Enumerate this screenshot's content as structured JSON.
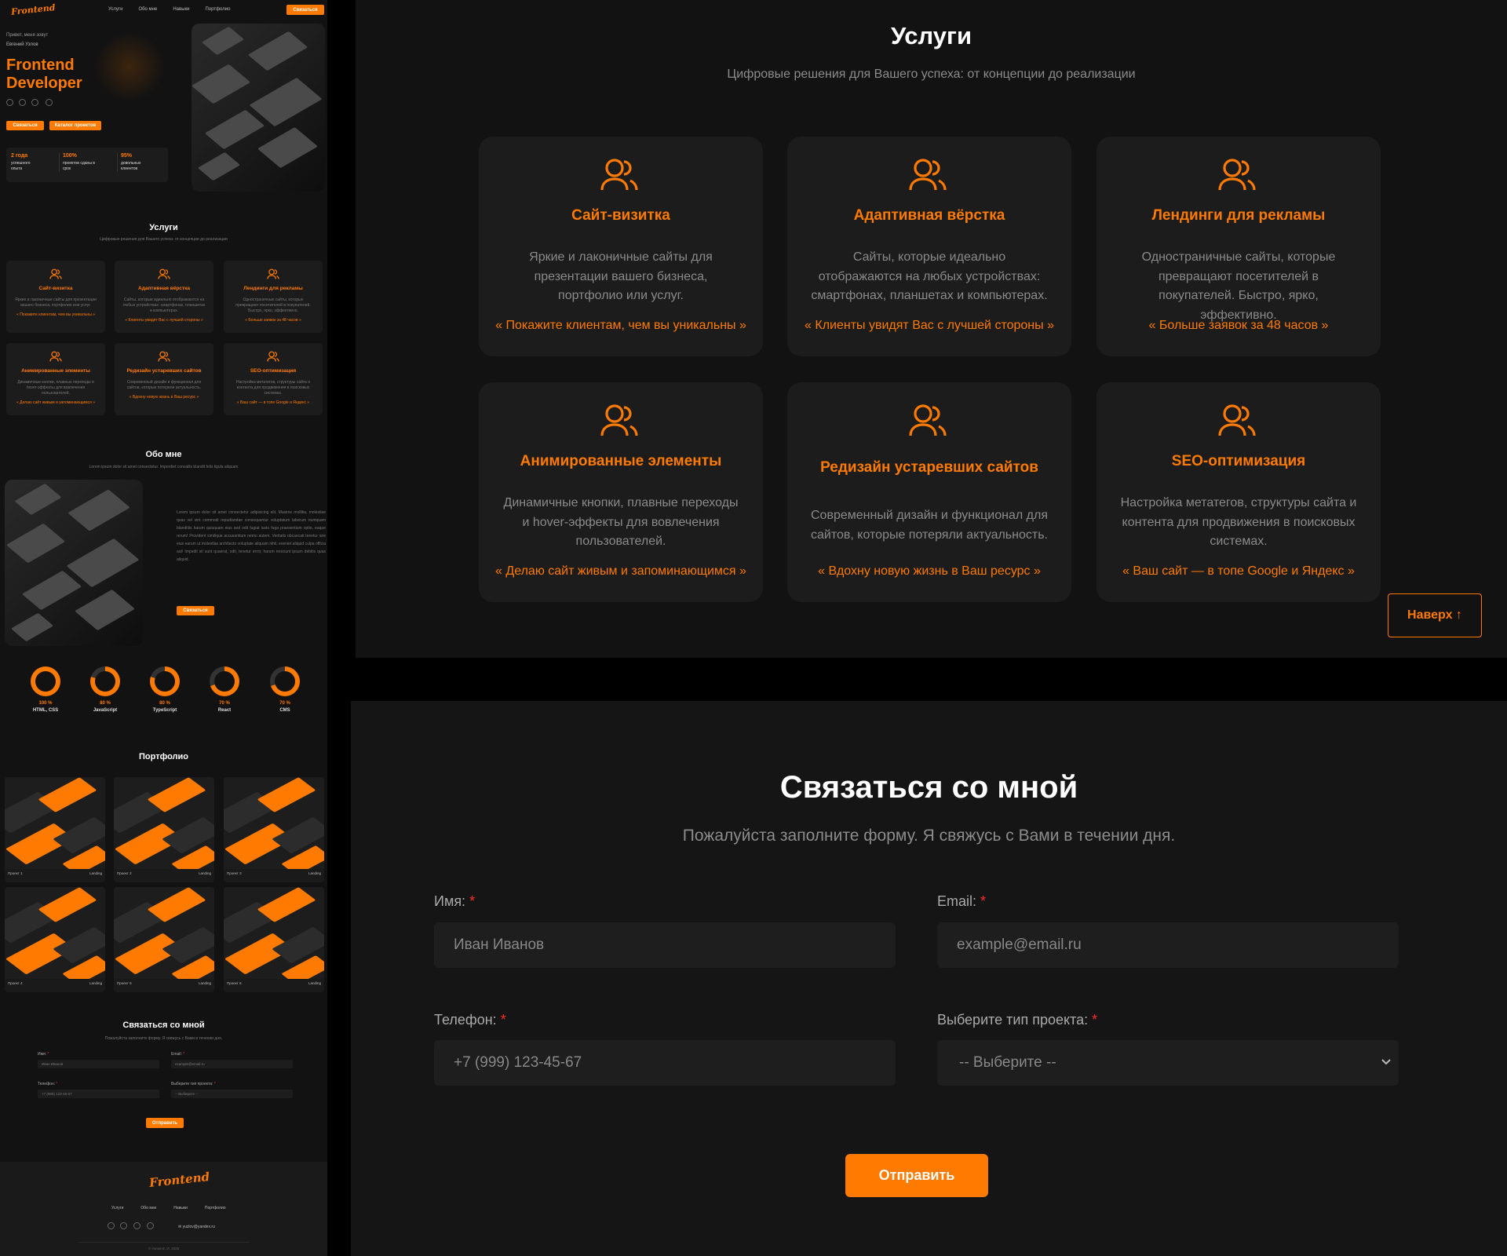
{
  "brand": {
    "logo": "Frontend",
    "accent": "#ff7a00"
  },
  "nav": {
    "links": [
      "Услуги",
      "Обо мне",
      "Навыки",
      "Портфолио"
    ],
    "cta": "Связаться"
  },
  "hero": {
    "greeting": "Привет, меня зовут",
    "name": "Евгений Узлов",
    "title_line1": "Frontend",
    "title_line2": "Developer",
    "btn_contact": "Связаться",
    "btn_projects": "Каталог проектов",
    "stats": [
      {
        "value": "2 года",
        "label1": "успешного",
        "label2": "опыта"
      },
      {
        "value": "100%",
        "label1": "проектов сданы в",
        "label2": "срок"
      },
      {
        "value": "95%",
        "label1": "довольных",
        "label2": "клиентов"
      }
    ]
  },
  "services": {
    "title": "Услуги",
    "subtitle": "Цифровые решения для Вашего успеха: от концепции до реализации",
    "cards": [
      {
        "title": "Сайт-визитка",
        "desc": "Яркие и лаконичные сайты для презентации вашего бизнеса, портфолио или услуг.",
        "quote": "« Покажите клиентам, чем вы уникальны »"
      },
      {
        "title": "Адаптивная вёрстка",
        "desc": "Сайты, которые идеально отображаются на любых устройствах: смартфонах, планшетах и компьютерах.",
        "quote": "« Клиенты увидят Вас с лучшей стороны »"
      },
      {
        "title": "Лендинги для рекламы",
        "desc": "Одностраничные сайты, которые превращают посетителей в покупателей. Быстро, ярко, эффективно.",
        "quote": "« Больше заявок за 48 часов »"
      },
      {
        "title": "Анимированные элементы",
        "desc": "Динамичные кнопки, плавные переходы и hover-эффекты для вовлечения пользователей.",
        "quote": "« Делаю сайт живым и запоминающимся »"
      },
      {
        "title": "Редизайн устаревших сайтов",
        "desc": "Современный дизайн и функционал для сайтов, которые потеряли актуальность.",
        "quote": "« Вдохну новую жизнь в Ваш ресурс »"
      },
      {
        "title": "SEO-оптимизация",
        "desc": "Настройка метатегов, структуры сайта и контента для продвижения в поисковых системах.",
        "quote": "« Ваш сайт — в топе Google и Яндекс »"
      }
    ],
    "top_button": "Наверх ↑"
  },
  "about": {
    "title": "Обо мне",
    "subtitle": "Lorem ipsum dolor sit amet consectetur. Imperdiet convallis blandit felis ligula aliquam",
    "text": "Lorem ipsum dolor sit amet consectetur adipisicing elit. Maxime mollitia, molestiae quas vel sint commodi repudiandae consequuntur voluptatum laborum numquam blanditiis harum quisquam eius sed odit fugiat iusto fuga praesentium optio, eaque rerum! Provident similique accusantium nemo autem. Veritatis obcaecati tenetur iure eius earum ut molestias architecto voluptate aliquam nihil, eveniet aliquid culpa officia aut! Impedit sit sunt quaerat, odit, tenetur error, harum nesciunt ipsum debitis quas aliquid.",
    "button": "Связаться"
  },
  "skills": [
    {
      "percent": "100 %",
      "name": "HTML, CSS",
      "value": 100
    },
    {
      "percent": "80 %",
      "name": "JavaScript",
      "value": 80
    },
    {
      "percent": "80 %",
      "name": "TypeScript",
      "value": 80
    },
    {
      "percent": "70 %",
      "name": "React",
      "value": 70
    },
    {
      "percent": "70 %",
      "name": "CMS",
      "value": 70
    }
  ],
  "portfolio": {
    "title": "Портфолио",
    "items": [
      {
        "name": "Проект 1",
        "tag": "Landing"
      },
      {
        "name": "Проект 2",
        "tag": "Landing"
      },
      {
        "name": "Проект 3",
        "tag": "Landing"
      },
      {
        "name": "Проект 4",
        "tag": "Landing"
      },
      {
        "name": "Проект 5",
        "tag": "Landing"
      },
      {
        "name": "Проект 6",
        "tag": "Landing"
      }
    ]
  },
  "contact": {
    "title": "Связаться со мной",
    "subtitle": "Пожалуйста заполните форму. Я свяжусь с Вами в течении дня.",
    "name_label": "Имя:",
    "name_placeholder": "Иван Иванов",
    "email_label": "Email:",
    "email_placeholder": "example@email.ru",
    "phone_label": "Телефон:",
    "phone_placeholder": "+7 (999) 123-45-67",
    "type_label": "Выберите тип проекта:",
    "type_selected": "-- Выберите --",
    "required_mark": "*",
    "submit": "Отправить"
  },
  "footer": {
    "email": "yuzlov@yandex.ru",
    "copyright": "© Узлов Е. И. 2025"
  }
}
